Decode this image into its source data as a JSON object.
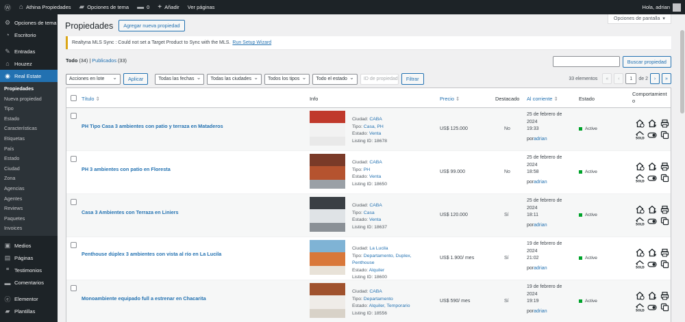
{
  "adminbar": {
    "site_name": "Athina Propiedades",
    "theme_options": "Opciones de tema",
    "comments_count": "0",
    "add_new": "Añadir",
    "view_pages": "Ver páginas",
    "greeting": "Hola, adrian"
  },
  "sidebar": {
    "items": [
      {
        "label": "Opciones de tema",
        "icon": "gear-icon"
      },
      {
        "label": "Escritorio",
        "icon": "dashboard-icon"
      },
      {
        "label": "Entradas",
        "icon": "pin-icon"
      },
      {
        "label": "Houzez",
        "icon": "home-icon"
      },
      {
        "label": "Real Estate",
        "icon": "location-icon"
      }
    ],
    "submenu": [
      "Propiedades",
      "Nueva propiedad",
      "Tipo",
      "Estado",
      "Características",
      "Etiquetas",
      "País",
      "Estado",
      "Ciudad",
      "Zona",
      "Agencias",
      "Agentes",
      "Reviews",
      "Paquetes",
      "Invoices"
    ],
    "bottom_items": [
      {
        "label": "Medios",
        "icon": "media-icon"
      },
      {
        "label": "Páginas",
        "icon": "pages-icon"
      },
      {
        "label": "Testimonios",
        "icon": "quote-icon"
      },
      {
        "label": "Comentarios",
        "icon": "comment-icon"
      },
      {
        "label": "Elementor",
        "icon": "elementor-icon"
      },
      {
        "label": "Plantillas",
        "icon": "folder-icon"
      }
    ]
  },
  "page": {
    "title": "Propiedades",
    "add_new": "Agregar nueva propiedad",
    "screen_options": "Opciones de pantalla",
    "notice_text": "Realtyna MLS Sync : Could not set a Target Product to Sync with the MLS.",
    "notice_link": "Run Setup Wizard",
    "filter_all": "Todo",
    "filter_all_count": "(34)",
    "filter_published": "Publicados",
    "filter_published_count": "(33)",
    "search_button": "Buscar propiedad",
    "bulk_actions": "Acciones en lote",
    "apply": "Aplicar",
    "all_dates": "Todas las fechas",
    "all_cities": "Todas las ciudades",
    "all_types": "Todos los tipos",
    "all_status": "Todo el estado",
    "id_placeholder": "ID de propiedad",
    "filter_button": "Filtrar",
    "items_count": "33 elementos",
    "page_current": "1",
    "page_of": "de 2"
  },
  "table": {
    "headers": {
      "title": "Título",
      "info": "Info",
      "price": "Precio",
      "featured": "Destacado",
      "current": "Al corriente",
      "status": "Estado",
      "behavior": "Comportamient o"
    },
    "rows": [
      {
        "title": "PH Tipo Casa 3 ambientes con patio y terraza en Mataderos",
        "city": "CABA",
        "type": "Casa, PH",
        "status": "Venta",
        "listing": "Listing ID: 18678",
        "price": "US$ 125.000",
        "featured": "No",
        "date1": "25 de febrero de",
        "date2": "2024",
        "time": "19:33",
        "author": "adrian",
        "state": "Active",
        "colors": [
          "#f2f2f2",
          "#c0392b",
          "#e9e9e9"
        ]
      },
      {
        "title": "PH 3 ambientes con patio en Floresta",
        "city": "CABA",
        "type": "PH",
        "status": "Venta",
        "listing": "Listing ID: 18650",
        "price": "US$ 99.000",
        "featured": "No",
        "date1": "25 de febrero de",
        "date2": "2024",
        "time": "18:58",
        "author": "adrian",
        "state": "Active",
        "colors": [
          "#b5532f",
          "#7a3a28",
          "#9aa0a6"
        ]
      },
      {
        "title": "Casa 3 Ambientes con Terraza en Liniers",
        "city": "CABA",
        "type": "Casa",
        "status": "Venta",
        "listing": "Listing ID: 18637",
        "price": "US$ 120.000",
        "featured": "Sí",
        "date1": "25 de febrero de",
        "date2": "2024",
        "time": "18:11",
        "author": "adrian",
        "state": "Active",
        "colors": [
          "#dfe3e6",
          "#3a3f44",
          "#8a9096"
        ]
      },
      {
        "title": "Penthouse dúplex 3 ambientes con vista al río en La Lucila",
        "city": "La Lucila",
        "type": "Departamento, Duplex, Penthouse",
        "status": "Alquiler",
        "listing": "Listing ID: 18600",
        "price": "US$ 1.900/ mes",
        "featured": "Sí",
        "date1": "19 de febrero de",
        "date2": "2024",
        "time": "21:02",
        "author": "adrian",
        "state": "Active",
        "colors": [
          "#d9783a",
          "#7fb3d5",
          "#e8e2d8"
        ]
      },
      {
        "title": "Monoambiente equipado full a estrenar en Chacarita",
        "city": "CABA",
        "type": "Departamento",
        "status": "Alquiler, Temporario",
        "listing": "Listing ID: 18556",
        "price": "US$ 590/ mes",
        "featured": "Sí",
        "date1": "19 de febrero de",
        "date2": "2024",
        "time": "19:19",
        "author": "adrian",
        "state": "Active",
        "colors": [
          "#efece8",
          "#a0522d",
          "#d8d2c8"
        ]
      }
    ],
    "labels": {
      "city": "Ciudad:",
      "type": "Tipo:",
      "status": "Estado:",
      "by": "por"
    }
  }
}
